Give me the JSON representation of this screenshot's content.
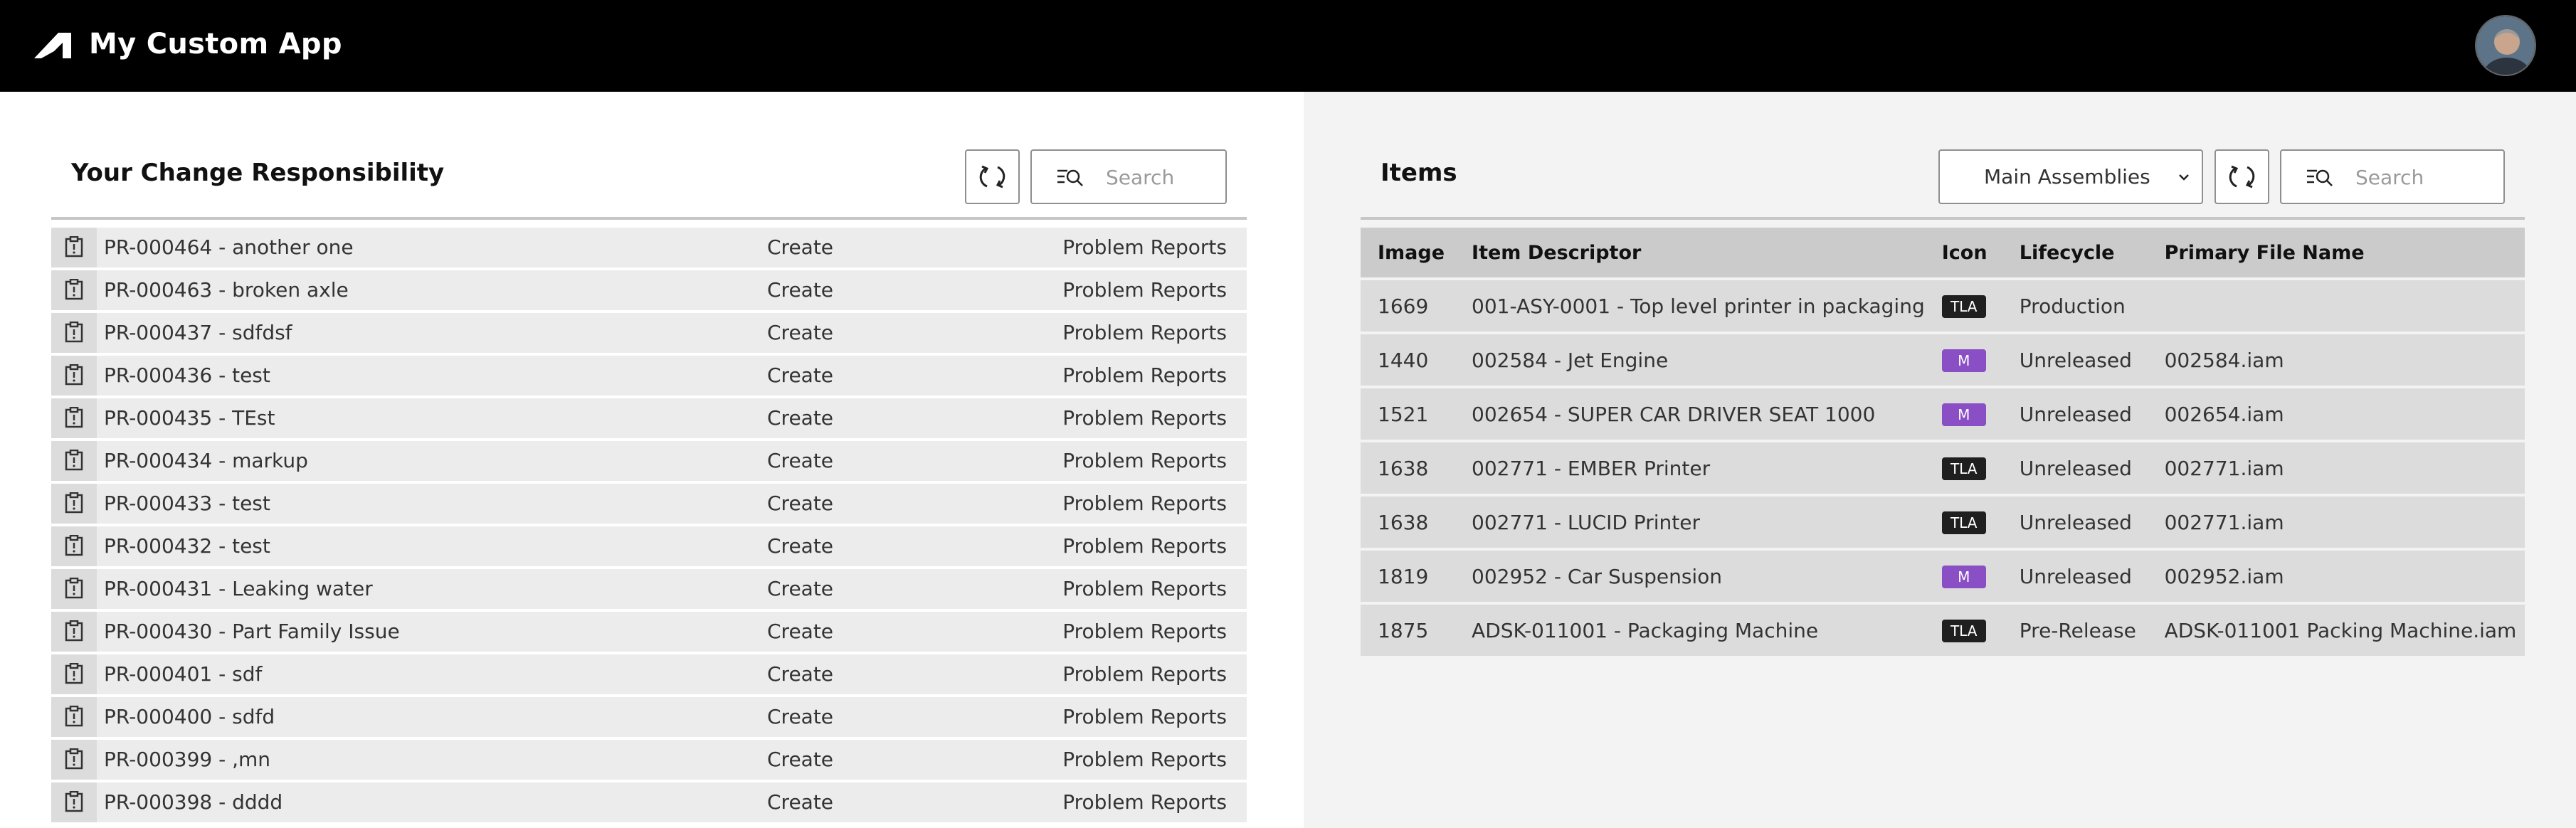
{
  "header": {
    "title": "My Custom App"
  },
  "left": {
    "title": "Your Change Responsibility",
    "search_placeholder": "Search",
    "rows": [
      {
        "title": "PR-000464 - another one",
        "action": "Create",
        "workspace": "Problem Reports"
      },
      {
        "title": "PR-000463 - broken axle",
        "action": "Create",
        "workspace": "Problem Reports"
      },
      {
        "title": "PR-000437 - sdfdsf",
        "action": "Create",
        "workspace": "Problem Reports"
      },
      {
        "title": "PR-000436 - test",
        "action": "Create",
        "workspace": "Problem Reports"
      },
      {
        "title": "PR-000435 - TEst",
        "action": "Create",
        "workspace": "Problem Reports"
      },
      {
        "title": "PR-000434 - markup",
        "action": "Create",
        "workspace": "Problem Reports"
      },
      {
        "title": "PR-000433 - test",
        "action": "Create",
        "workspace": "Problem Reports"
      },
      {
        "title": "PR-000432 - test",
        "action": "Create",
        "workspace": "Problem Reports"
      },
      {
        "title": "PR-000431 - Leaking water",
        "action": "Create",
        "workspace": "Problem Reports"
      },
      {
        "title": "PR-000430 - Part Family Issue",
        "action": "Create",
        "workspace": "Problem Reports"
      },
      {
        "title": "PR-000401 - sdf",
        "action": "Create",
        "workspace": "Problem Reports"
      },
      {
        "title": "PR-000400 - sdfd",
        "action": "Create",
        "workspace": "Problem Reports"
      },
      {
        "title": "PR-000399 - ,mn",
        "action": "Create",
        "workspace": "Problem Reports"
      },
      {
        "title": "PR-000398 - dddd",
        "action": "Create",
        "workspace": "Problem Reports"
      }
    ]
  },
  "right": {
    "title": "Items",
    "view_select": "Main Assemblies",
    "search_placeholder": "Search",
    "columns": [
      "Image",
      "Item Descriptor",
      "Icon",
      "Lifecycle",
      "Primary File Name"
    ],
    "rows": [
      {
        "image": "1669",
        "descriptor": "001-ASY-0001 - Top level printer in packaging",
        "icon": "TLA",
        "lifecycle": "Production",
        "file": ""
      },
      {
        "image": "1440",
        "descriptor": "002584 - Jet Engine",
        "icon": "M",
        "lifecycle": "Unreleased",
        "file": "002584.iam"
      },
      {
        "image": "1521",
        "descriptor": "002654 - SUPER CAR DRIVER SEAT 1000",
        "icon": "M",
        "lifecycle": "Unreleased",
        "file": "002654.iam"
      },
      {
        "image": "1638",
        "descriptor": "002771 - EMBER Printer",
        "icon": "TLA",
        "lifecycle": "Unreleased",
        "file": "002771.iam"
      },
      {
        "image": "1638",
        "descriptor": "002771 - LUCID Printer",
        "icon": "TLA",
        "lifecycle": "Unreleased",
        "file": "002771.iam"
      },
      {
        "image": "1819",
        "descriptor": "002952 - Car Suspension",
        "icon": "M",
        "lifecycle": "Unreleased",
        "file": "002952.iam"
      },
      {
        "image": "1875",
        "descriptor": "ADSK-011001 - Packaging Machine",
        "icon": "TLA",
        "lifecycle": "Pre-Release",
        "file": "ADSK-011001 Packing Machine.iam"
      }
    ]
  },
  "colors": {
    "header_bg": "#000000",
    "badge_tla": "#1f1f1f",
    "badge_m": "#8a4fc4",
    "right_bg": "#f3f3f3"
  }
}
